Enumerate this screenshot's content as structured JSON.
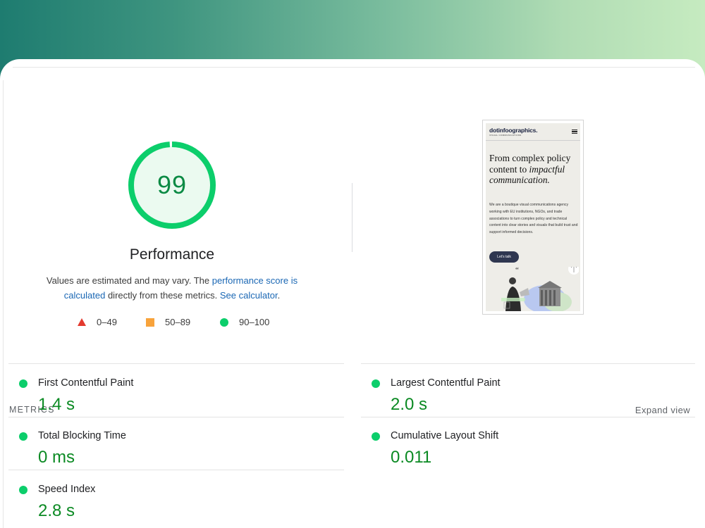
{
  "performance": {
    "score": "99",
    "title": "Performance",
    "description": {
      "part1": "Values are estimated and may vary. The ",
      "link1": "performance score is calculated",
      "part2": " directly from these metrics. ",
      "link2": "See calculator",
      "part3": "."
    },
    "score_fraction": 0.99,
    "color": "#0cce6b"
  },
  "legend": [
    {
      "label": "0–49",
      "shape": "triangle",
      "color": "#e33a2f"
    },
    {
      "label": "50–89",
      "shape": "square",
      "color": "#f8a33b"
    },
    {
      "label": "90–100",
      "shape": "circle",
      "color": "#0cce6b"
    }
  ],
  "screenshot": {
    "logo": "dotinfoographics.",
    "logo_sub": "VISUAL COMMUNICATIONS",
    "heading_plain": "From complex policy content to",
    "heading_italic": "impactful communication.",
    "body": "We are a boutique visual communications agency working with EU institutions, NGOs, and trade associations to turn complex policy and technical content into clear stories and visuals that build trust and support informed decisions.",
    "cta": "Let’s talk"
  },
  "metrics": {
    "label": "METRICS",
    "expand": "Expand view",
    "items": [
      {
        "title": "First Contentful Paint",
        "value": "1.4 s"
      },
      {
        "title": "Largest Contentful Paint",
        "value": "2.0 s"
      },
      {
        "title": "Total Blocking Time",
        "value": "0 ms"
      },
      {
        "title": "Cumulative Layout Shift",
        "value": "0.011"
      },
      {
        "title": "Speed Index",
        "value": "2.8 s"
      }
    ]
  }
}
